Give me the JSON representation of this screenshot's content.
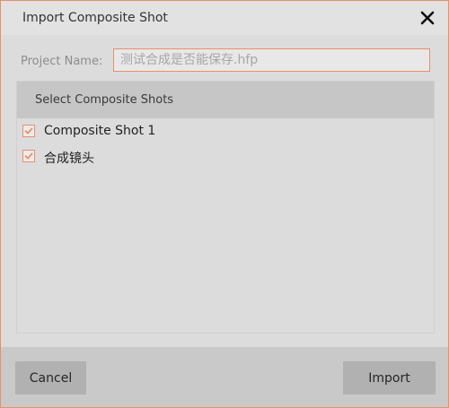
{
  "dialog": {
    "title": "Import Composite Shot",
    "close_icon": "close-icon"
  },
  "project": {
    "label": "Project Name:",
    "value": "",
    "placeholder": "测试合成是否能保存.hfp"
  },
  "shots_panel": {
    "header": "Select Composite Shots",
    "items": [
      {
        "label": "Composite Shot 1",
        "checked": true
      },
      {
        "label": "合成镜头",
        "checked": true
      }
    ]
  },
  "footer": {
    "cancel_label": "Cancel",
    "import_label": "Import"
  },
  "colors": {
    "accent": "#e8906e",
    "background": "#dcdcdc",
    "header": "#c6c6c6",
    "footer": "#c9c9c9",
    "button": "#b1b1b1"
  }
}
